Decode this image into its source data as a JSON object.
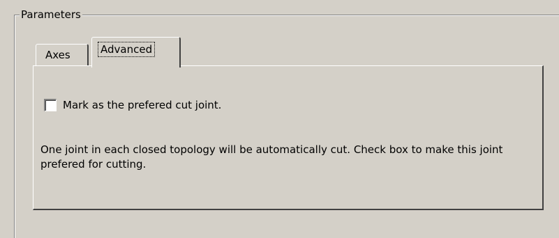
{
  "groupbox": {
    "title": "Parameters"
  },
  "tabs": [
    {
      "label": "Axes",
      "selected": false
    },
    {
      "label": "Advanced",
      "selected": true
    }
  ],
  "advanced": {
    "checkbox_label": "Mark as the prefered cut joint.",
    "checkbox_checked": false,
    "description": "One joint in each closed topology will be automatically cut. Check box to make this joint prefered for cutting."
  }
}
